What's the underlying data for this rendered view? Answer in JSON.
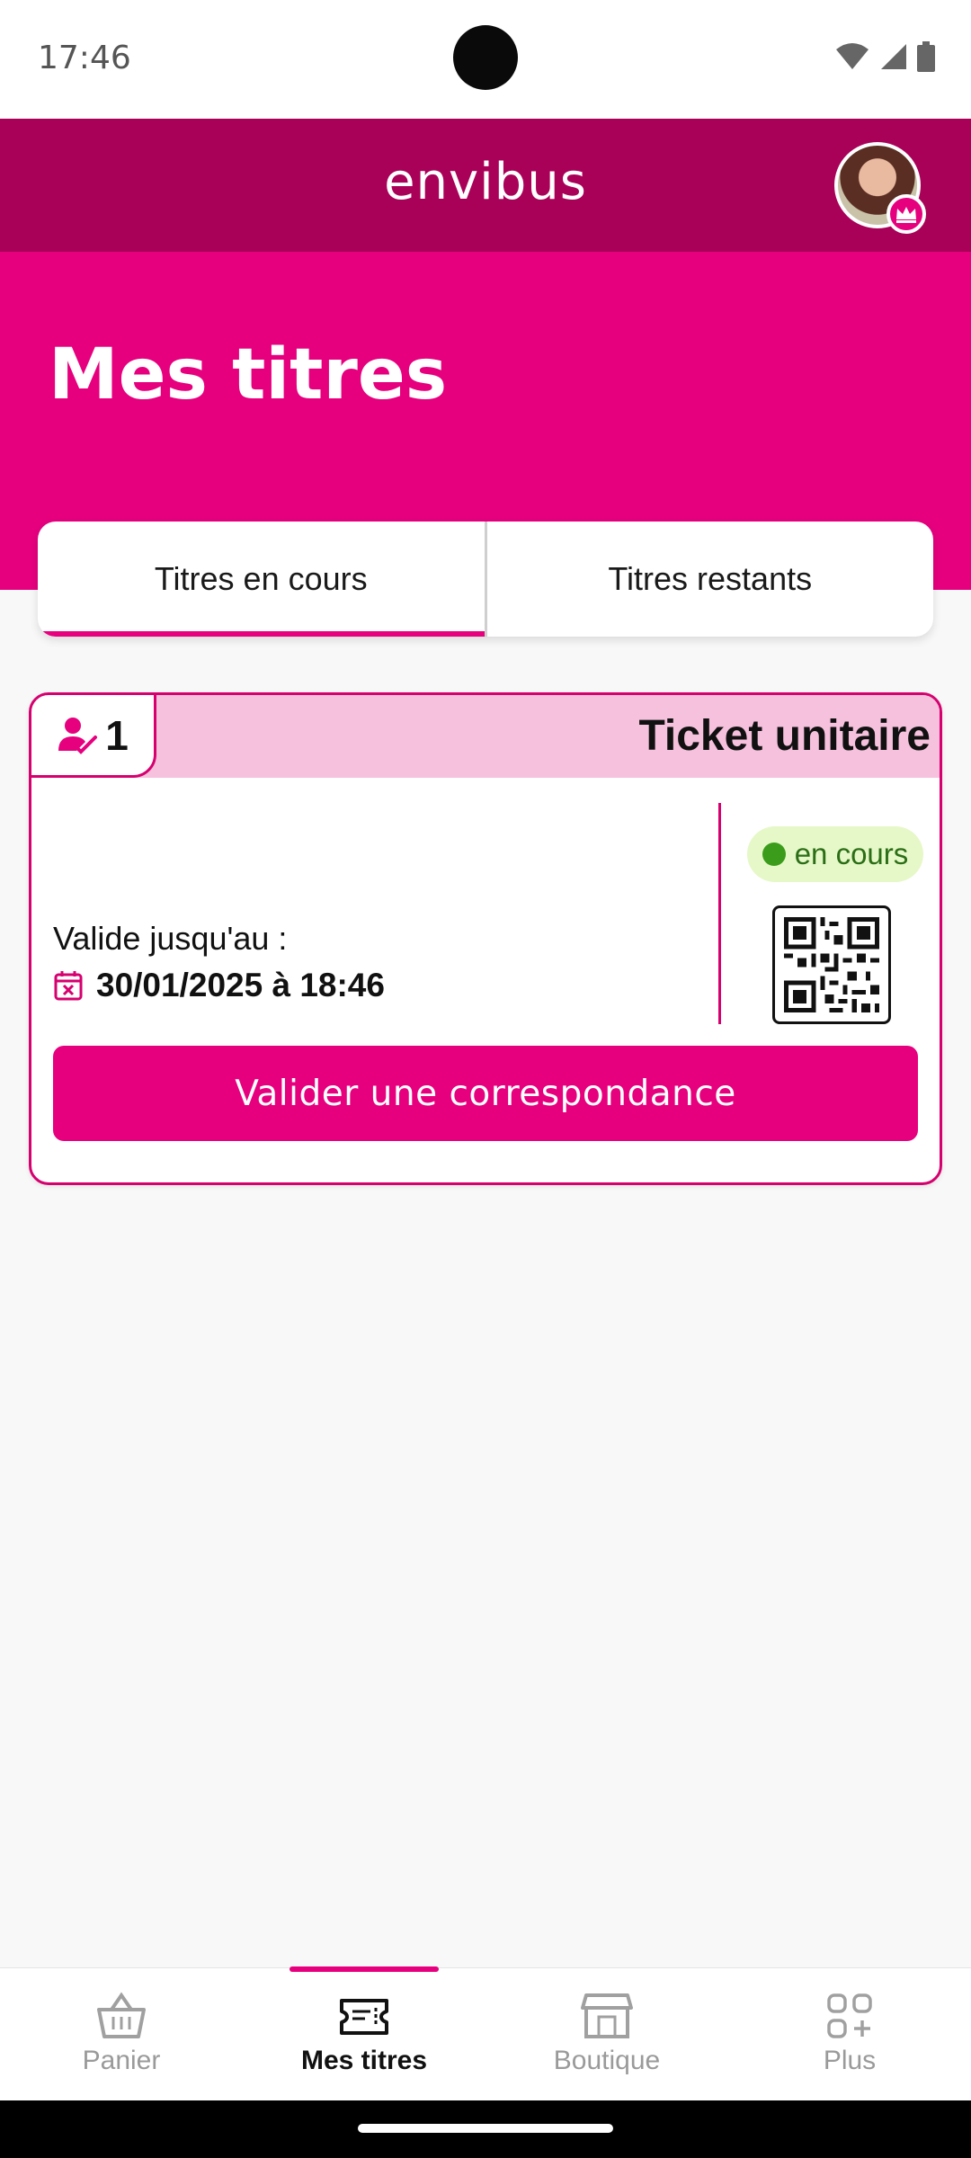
{
  "status_bar": {
    "time": "17:46",
    "icons": [
      "wifi-icon",
      "signal-icon",
      "battery-icon"
    ]
  },
  "header": {
    "logo_text": "envibus",
    "avatar": "user-avatar",
    "badge_icon": "crown-icon"
  },
  "page": {
    "title": "Mes titres"
  },
  "tabs": [
    {
      "label": "Titres en cours",
      "active": true
    },
    {
      "label": "Titres restants",
      "active": false
    }
  ],
  "ticket": {
    "passenger_count": "1",
    "passenger_icon": "passenger-check-icon",
    "name": "Ticket unitaire",
    "validity_label": "Valide jusqu'au :",
    "validity_icon": "calendar-x-icon",
    "validity_date": "30/01/2025 à 18:46",
    "status": "en cours",
    "status_color": "#3a9c1a",
    "qr_icon": "qr-code-icon",
    "action_label": "Valider une correspondance"
  },
  "bottom_nav": [
    {
      "label": "Panier",
      "icon": "basket-icon",
      "active": false
    },
    {
      "label": "Mes titres",
      "icon": "ticket-icon",
      "active": true
    },
    {
      "label": "Boutique",
      "icon": "store-icon",
      "active": false
    },
    {
      "label": "Plus",
      "icon": "more-grid-icon",
      "active": false
    }
  ],
  "colors": {
    "brand_dark": "#a90058",
    "brand": "#e6007e",
    "ticket_header": "#f6c1dd",
    "status_bg": "#e6f8c8"
  }
}
